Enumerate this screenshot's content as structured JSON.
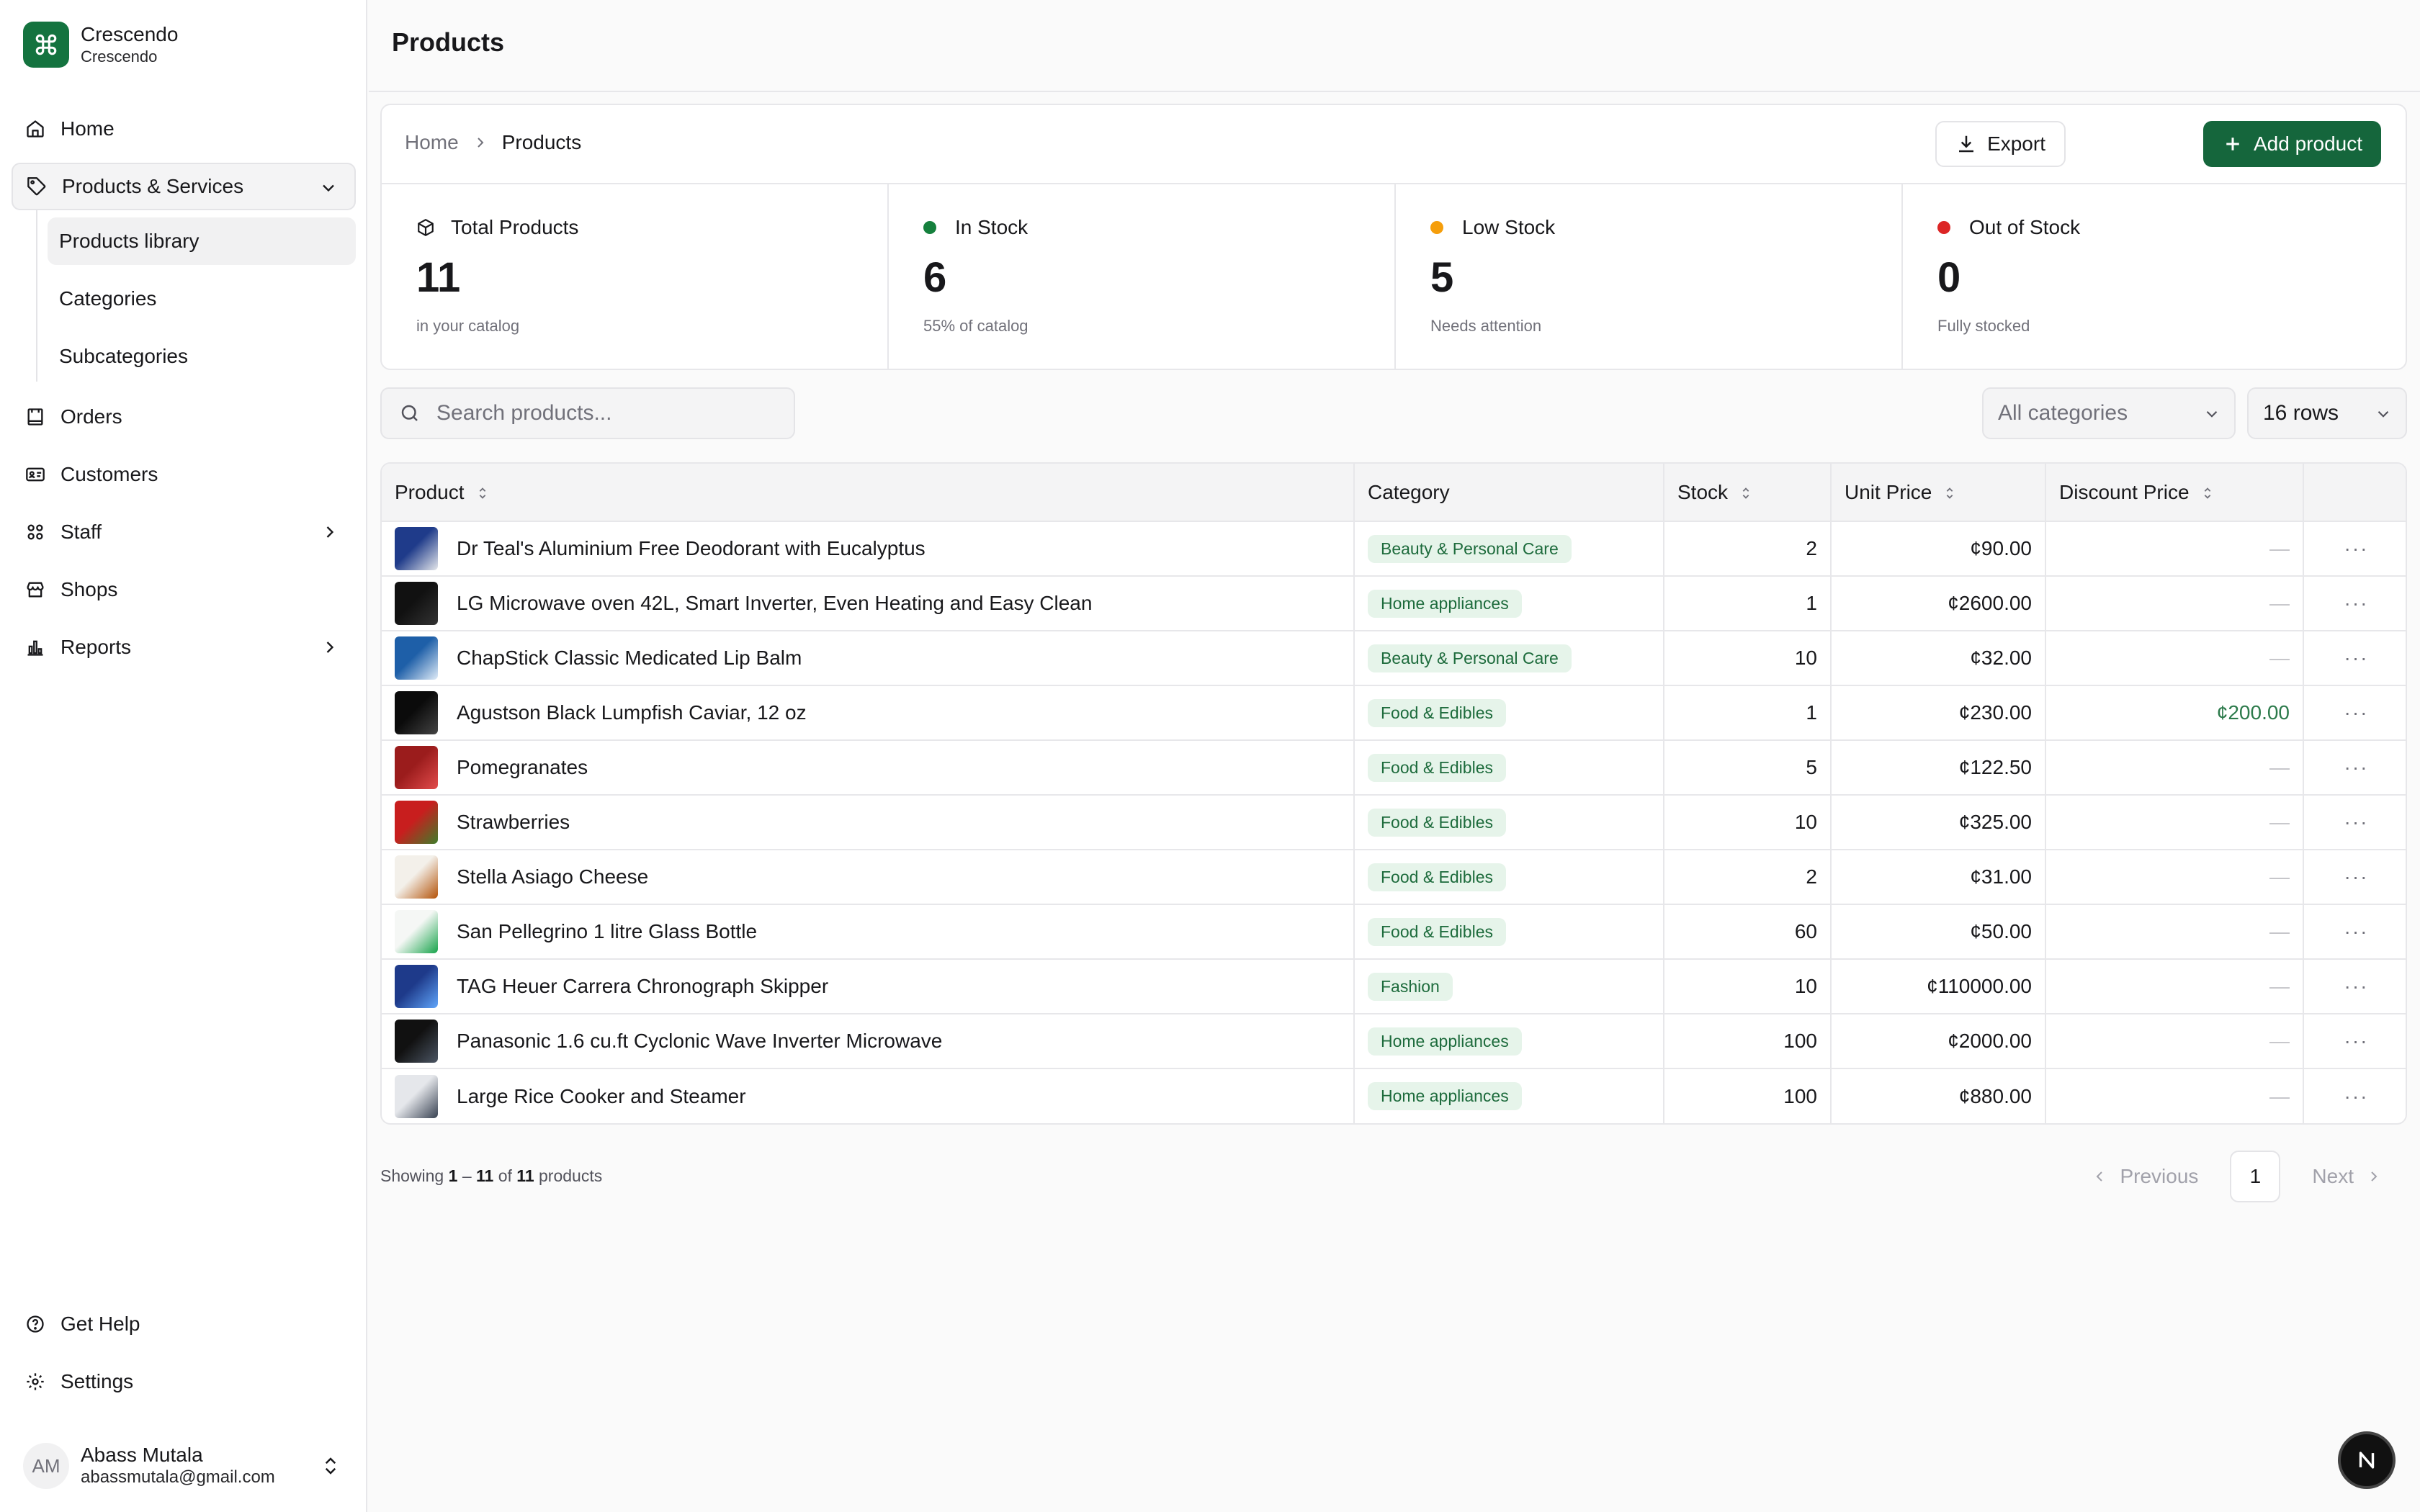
{
  "brand": {
    "name": "Crescendo",
    "subtitle": "Crescendo",
    "logo_icon": "command-icon"
  },
  "sidebar": {
    "home": "Home",
    "products_services": "Products & Services",
    "sub_items": [
      "Products library",
      "Categories",
      "Subcategories"
    ],
    "orders": "Orders",
    "customers": "Customers",
    "staff": "Staff",
    "shops": "Shops",
    "reports": "Reports",
    "get_help": "Get Help",
    "settings": "Settings"
  },
  "user": {
    "initials": "AM",
    "name": "Abass Mutala",
    "email": "abassmutala@gmail.com"
  },
  "header": {
    "title": "Products"
  },
  "breadcrumb": {
    "home": "Home",
    "current": "Products"
  },
  "actions": {
    "export": "Export",
    "add_product": "Add product"
  },
  "stats": [
    {
      "label": "Total Products",
      "value": "11",
      "sub": "in your catalog",
      "indicator": "cube-icon"
    },
    {
      "label": "In Stock",
      "value": "6",
      "sub": "55% of catalog",
      "indicator": "#15803d"
    },
    {
      "label": "Low Stock",
      "value": "5",
      "sub": "Needs attention",
      "indicator": "#f59e0b"
    },
    {
      "label": "Out of Stock",
      "value": "0",
      "sub": "Fully stocked",
      "indicator": "#dc2626"
    }
  ],
  "filters": {
    "search_placeholder": "Search products...",
    "category": "All categories",
    "rows": "16 rows"
  },
  "table": {
    "columns": [
      "Product",
      "Category",
      "Stock",
      "Unit Price",
      "Discount Price"
    ],
    "rows": [
      {
        "product": "Dr Teal's Aluminium Free Deodorant with Eucalyptus",
        "category": "Beauty & Personal Care",
        "stock": "2",
        "price": "¢90.00",
        "discount": "—"
      },
      {
        "product": "LG Microwave oven 42L, Smart Inverter, Even Heating and Easy Clean",
        "category": "Home appliances",
        "stock": "1",
        "price": "¢2600.00",
        "discount": "—"
      },
      {
        "product": "ChapStick Classic Medicated Lip Balm",
        "category": "Beauty & Personal Care",
        "stock": "10",
        "price": "¢32.00",
        "discount": "—"
      },
      {
        "product": "Agustson Black Lumpfish Caviar, 12 oz",
        "category": "Food & Edibles",
        "stock": "1",
        "price": "¢230.00",
        "discount": "¢200.00"
      },
      {
        "product": "Pomegranates",
        "category": "Food & Edibles",
        "stock": "5",
        "price": "¢122.50",
        "discount": "—"
      },
      {
        "product": "Strawberries",
        "category": "Food & Edibles",
        "stock": "10",
        "price": "¢325.00",
        "discount": "—"
      },
      {
        "product": "Stella Asiago Cheese",
        "category": "Food & Edibles",
        "stock": "2",
        "price": "¢31.00",
        "discount": "—"
      },
      {
        "product": "San Pellegrino 1 litre Glass Bottle",
        "category": "Food & Edibles",
        "stock": "60",
        "price": "¢50.00",
        "discount": "—"
      },
      {
        "product": "TAG Heuer Carrera Chronograph Skipper",
        "category": "Fashion",
        "stock": "10",
        "price": "¢110000.00",
        "discount": "—"
      },
      {
        "product": "Panasonic 1.6 cu.ft Cyclonic Wave Inverter Microwave",
        "category": "Home appliances",
        "stock": "100",
        "price": "¢2000.00",
        "discount": "—"
      },
      {
        "product": "Large Rice Cooker and Steamer",
        "category": "Home appliances",
        "stock": "100",
        "price": "¢880.00",
        "discount": "—"
      }
    ]
  },
  "footer": {
    "showing_prefix": "Showing",
    "range_start": "1",
    "range_sep": "–",
    "range_end": "11",
    "of": "of",
    "total": "11",
    "suffix": "products"
  },
  "pagination": {
    "previous": "Previous",
    "current_page": "1",
    "next": "Next"
  },
  "fab": {
    "label": "N"
  }
}
